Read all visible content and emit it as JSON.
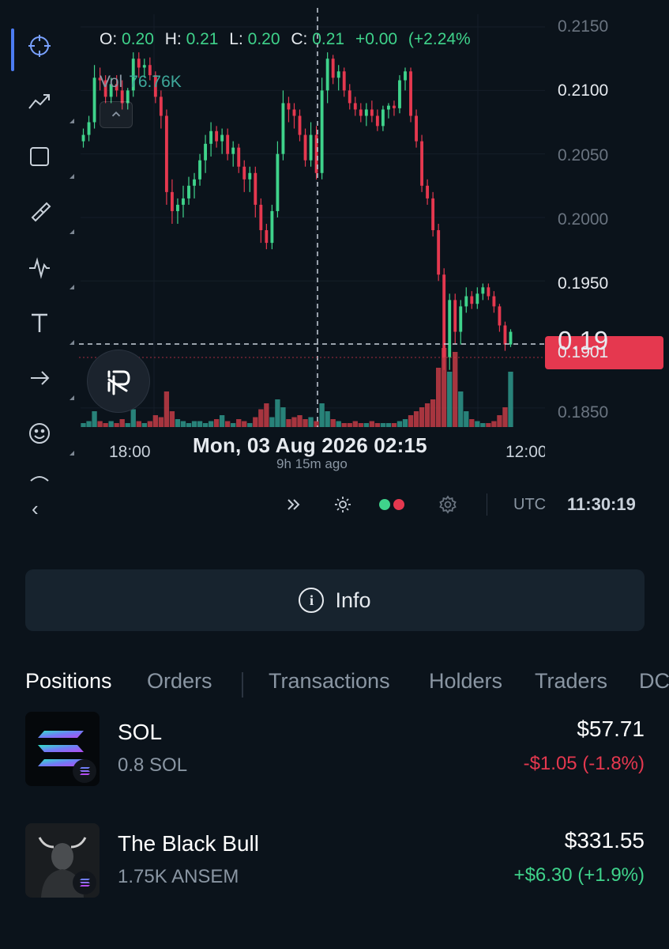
{
  "toolbar": {
    "items": [
      "crosshair-icon",
      "trend-line-icon",
      "rectangle-icon",
      "brush-icon",
      "pattern-icon",
      "text-icon",
      "arrow-icon",
      "emoji-icon",
      "more-icon"
    ]
  },
  "chart": {
    "ohlc": {
      "o_label": "O:",
      "o": "0.20",
      "h_label": "H:",
      "h": "0.21",
      "l_label": "L:",
      "l": "0.20",
      "c_label": "C:",
      "c": "0.21",
      "change": "+0.00",
      "change_pct": "(+2.24%"
    },
    "volume": {
      "label": "Vol",
      "value": "76.76K"
    },
    "price_axis": [
      "0.2150",
      "0.2100",
      "0.2050",
      "0.2000",
      "0.1950",
      "0.1850"
    ],
    "current_price_big": "0.19",
    "current_price_small": "0.1901",
    "time_axis": [
      "18:00",
      "12:00"
    ],
    "crosshair_date": "Mon, 03 Aug 2026 02:15",
    "crosshair_ago": "9h 15m ago",
    "colors": {
      "up": "#3fd38b",
      "down": "#e5384f",
      "vol_up": "#2b8f84",
      "vol_down": "#b83a44"
    }
  },
  "chart_data": {
    "type": "candlestick",
    "ylim": [
      0.1835,
      0.216
    ],
    "candles": [
      [
        0.206,
        0.207,
        0.2055,
        0.2065
      ],
      [
        0.2065,
        0.208,
        0.206,
        0.2075
      ],
      [
        0.2075,
        0.212,
        0.207,
        0.211
      ],
      [
        0.211,
        0.2118,
        0.21,
        0.2108
      ],
      [
        0.2108,
        0.2112,
        0.209,
        0.2095
      ],
      [
        0.2095,
        0.211,
        0.209,
        0.2105
      ],
      [
        0.2105,
        0.2112,
        0.2095,
        0.21
      ],
      [
        0.21,
        0.2108,
        0.2085,
        0.209
      ],
      [
        0.209,
        0.2102,
        0.2085,
        0.21
      ],
      [
        0.21,
        0.213,
        0.2095,
        0.2125
      ],
      [
        0.2125,
        0.213,
        0.211,
        0.2118
      ],
      [
        0.2118,
        0.2125,
        0.211,
        0.212
      ],
      [
        0.212,
        0.2126,
        0.2108,
        0.2112
      ],
      [
        0.2112,
        0.2115,
        0.209,
        0.2095
      ],
      [
        0.2095,
        0.21,
        0.207,
        0.208
      ],
      [
        0.208,
        0.2085,
        0.201,
        0.202
      ],
      [
        0.202,
        0.203,
        0.1995,
        0.2005
      ],
      [
        0.2005,
        0.2015,
        0.1995,
        0.201
      ],
      [
        0.201,
        0.2025,
        0.2,
        0.2015
      ],
      [
        0.2015,
        0.2032,
        0.201,
        0.2025
      ],
      [
        0.2025,
        0.2035,
        0.2015,
        0.203
      ],
      [
        0.203,
        0.205,
        0.2025,
        0.2045
      ],
      [
        0.2045,
        0.2065,
        0.2035,
        0.2058
      ],
      [
        0.2058,
        0.2075,
        0.2048,
        0.2068
      ],
      [
        0.2068,
        0.2072,
        0.2055,
        0.206
      ],
      [
        0.206,
        0.207,
        0.205,
        0.2065
      ],
      [
        0.2065,
        0.207,
        0.2045,
        0.205
      ],
      [
        0.205,
        0.206,
        0.204,
        0.2055
      ],
      [
        0.2055,
        0.2058,
        0.2035,
        0.204
      ],
      [
        0.204,
        0.2045,
        0.202,
        0.203
      ],
      [
        0.203,
        0.204,
        0.202,
        0.2035
      ],
      [
        0.2035,
        0.204,
        0.2,
        0.201
      ],
      [
        0.201,
        0.2015,
        0.198,
        0.199
      ],
      [
        0.199,
        0.1995,
        0.1975,
        0.198
      ],
      [
        0.198,
        0.201,
        0.1975,
        0.2005
      ],
      [
        0.2005,
        0.206,
        0.2,
        0.205
      ],
      [
        0.205,
        0.21,
        0.2045,
        0.209
      ],
      [
        0.209,
        0.2095,
        0.2075,
        0.2085
      ],
      [
        0.2085,
        0.209,
        0.207,
        0.208
      ],
      [
        0.208,
        0.2085,
        0.206,
        0.2065
      ],
      [
        0.2065,
        0.207,
        0.204,
        0.2045
      ],
      [
        0.2045,
        0.2075,
        0.204,
        0.2065
      ],
      [
        0.2065,
        0.2072,
        0.203,
        0.2035
      ],
      [
        0.2035,
        0.211,
        0.203,
        0.21
      ],
      [
        0.21,
        0.213,
        0.209,
        0.2125
      ],
      [
        0.2125,
        0.2128,
        0.2105,
        0.211
      ],
      [
        0.211,
        0.212,
        0.21,
        0.2115
      ],
      [
        0.2115,
        0.2118,
        0.2095,
        0.21
      ],
      [
        0.21,
        0.2105,
        0.2085,
        0.209
      ],
      [
        0.209,
        0.2095,
        0.208,
        0.2085
      ],
      [
        0.2085,
        0.209,
        0.2075,
        0.208
      ],
      [
        0.208,
        0.209,
        0.2072,
        0.2085
      ],
      [
        0.2085,
        0.2092,
        0.2075,
        0.208
      ],
      [
        0.208,
        0.2085,
        0.2068,
        0.2072
      ],
      [
        0.2072,
        0.2088,
        0.2068,
        0.2085
      ],
      [
        0.2085,
        0.209,
        0.2078,
        0.2088
      ],
      [
        0.2088,
        0.2092,
        0.208,
        0.2086
      ],
      [
        0.2086,
        0.2112,
        0.2082,
        0.2108
      ],
      [
        0.2108,
        0.2118,
        0.21,
        0.2115
      ],
      [
        0.2115,
        0.2118,
        0.2075,
        0.208
      ],
      [
        0.208,
        0.2085,
        0.2055,
        0.206
      ],
      [
        0.206,
        0.2065,
        0.202,
        0.2025
      ],
      [
        0.2025,
        0.203,
        0.201,
        0.2015
      ],
      [
        0.2015,
        0.202,
        0.1985,
        0.199
      ],
      [
        0.199,
        0.1995,
        0.195,
        0.1955
      ],
      [
        0.1955,
        0.196,
        0.188,
        0.189
      ],
      [
        0.189,
        0.194,
        0.188,
        0.1935
      ],
      [
        0.1935,
        0.194,
        0.19,
        0.191
      ],
      [
        0.191,
        0.1935,
        0.19,
        0.193
      ],
      [
        0.193,
        0.1945,
        0.1925,
        0.1938
      ],
      [
        0.1938,
        0.1942,
        0.1928,
        0.1932
      ],
      [
        0.1932,
        0.1945,
        0.1928,
        0.194
      ],
      [
        0.194,
        0.1948,
        0.1935,
        0.1945
      ],
      [
        0.1945,
        0.1948,
        0.1935,
        0.1938
      ],
      [
        0.1938,
        0.1942,
        0.1925,
        0.193
      ],
      [
        0.193,
        0.1932,
        0.191,
        0.1915
      ],
      [
        0.1915,
        0.1918,
        0.1895,
        0.19
      ],
      [
        0.19,
        0.1912,
        0.1898,
        0.191
      ]
    ],
    "volumes": [
      2,
      3,
      8,
      3,
      2,
      3,
      2,
      4,
      2,
      9,
      3,
      2,
      3,
      6,
      5,
      18,
      8,
      4,
      3,
      2,
      3,
      3,
      2,
      3,
      4,
      6,
      3,
      2,
      4,
      3,
      2,
      5,
      9,
      12,
      5,
      14,
      10,
      4,
      5,
      6,
      4,
      5,
      3,
      12,
      8,
      4,
      3,
      2,
      2,
      3,
      2,
      2,
      3,
      2,
      2,
      2,
      2,
      3,
      4,
      6,
      8,
      10,
      12,
      14,
      30,
      40,
      28,
      38,
      18,
      8,
      4,
      3,
      2,
      2,
      3,
      6,
      10,
      28
    ],
    "xlim_labels": [
      "18:00",
      "12:00"
    ]
  },
  "controls": {
    "utc": "UTC",
    "clock": "11:30:19"
  },
  "info_button": {
    "label": "Info"
  },
  "tabs": [
    "Positions",
    "Orders",
    "Transactions",
    "Holders",
    "Traders",
    "DC"
  ],
  "positions": [
    {
      "name": "SOL",
      "qty": "0.8 SOL",
      "value": "$57.71",
      "change": "-$1.05 (-1.8%)",
      "direction": "down"
    },
    {
      "name": "The Black Bull",
      "qty": "1.75K ANSEM",
      "value": "$331.55",
      "change": "+$6.30 (+1.9%)",
      "direction": "up"
    }
  ]
}
